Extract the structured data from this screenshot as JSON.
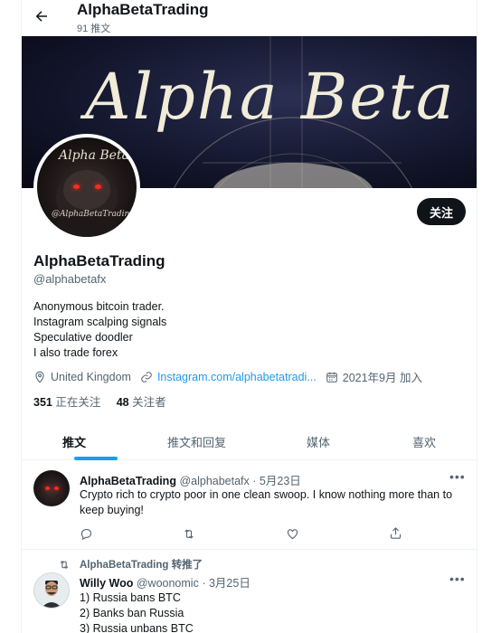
{
  "header": {
    "title": "AlphaBetaTrading",
    "tweet_count": "91 推文",
    "back_icon": "arrow-left-icon"
  },
  "banner": {
    "text": "Alpha Beta"
  },
  "avatar": {
    "title": "Alpha Beta",
    "footer": "@AlphaBetaTrading"
  },
  "profile": {
    "follow_label": "关注",
    "display_name": "AlphaBetaTrading",
    "handle": "@alphabetafx",
    "bio_lines": [
      "Anonymous bitcoin trader.",
      "Instagram scalping signals",
      "Speculative doodler",
      "I also trade forex"
    ],
    "location": "United Kingdom",
    "website": "Instagram.com/alphabetatradi...",
    "joined": "2021年9月 加入",
    "following_count": "351",
    "following_label": "正在关注",
    "followers_count": "48",
    "followers_label": "关注者"
  },
  "tabs": [
    {
      "label": "推文",
      "active": true
    },
    {
      "label": "推文和回复",
      "active": false
    },
    {
      "label": "媒体",
      "active": false
    },
    {
      "label": "喜欢",
      "active": false
    }
  ],
  "tweets": [
    {
      "name": "AlphaBetaTrading",
      "handle": "@alphabetafx",
      "sep": "·",
      "date": "5月23日",
      "text": "Crypto rich to crypto poor in one clean swoop. I know nothing more than to keep buying!",
      "more": "•••"
    },
    {
      "retweet_by": "AlphaBetaTrading 转推了",
      "name": "Willy Woo",
      "handle": "@woonomic",
      "sep": "·",
      "date": "3月25日",
      "lines": [
        "1) Russia bans BTC",
        "2) Banks ban Russia",
        "3) Russia unbans BTC"
      ],
      "more": "•••"
    }
  ],
  "colors": {
    "accent": "#1d9bf0",
    "text": "#0f1419",
    "muted": "#536471",
    "border": "#eff3f4"
  }
}
